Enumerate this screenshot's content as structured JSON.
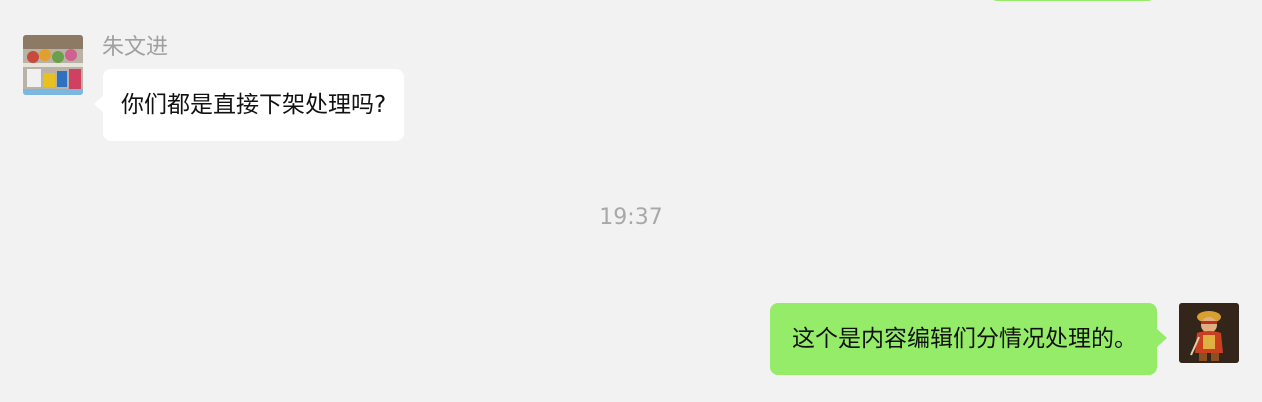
{
  "messages": [
    {
      "sender": "朱文进",
      "text": "你们都是直接下架处理吗?"
    },
    {
      "text": "这个是内容编辑们分情况处理的。"
    }
  ],
  "timestamp": "19:37",
  "colors": {
    "background": "#f2f2f2",
    "incoming_bubble": "#ffffff",
    "outgoing_bubble": "#95ec69"
  }
}
